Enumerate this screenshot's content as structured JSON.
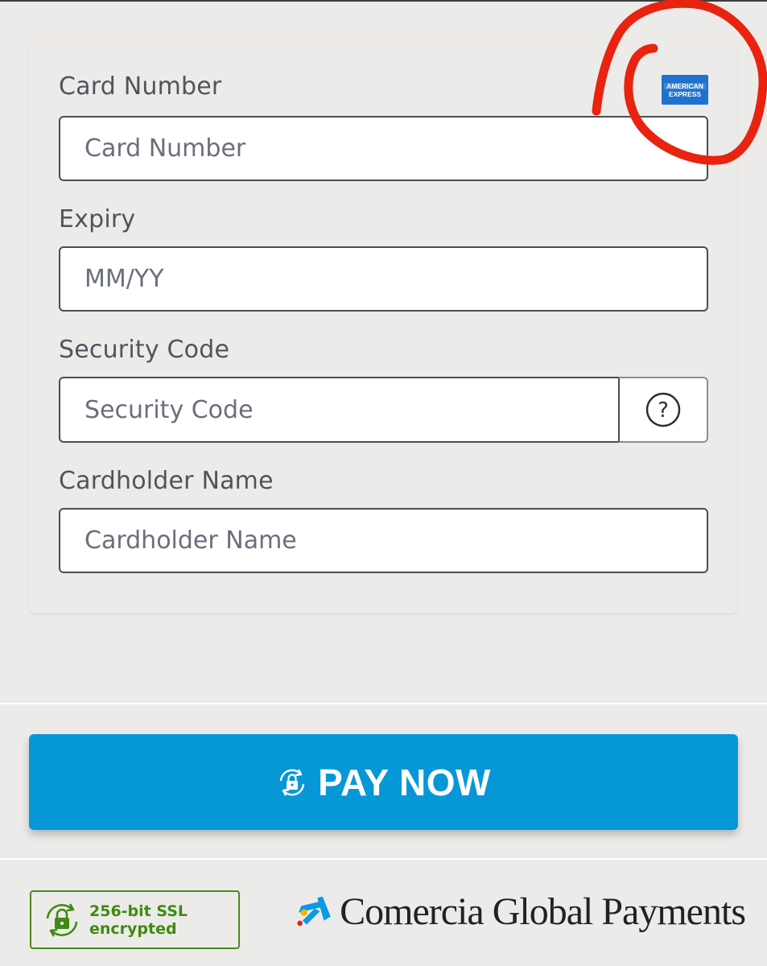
{
  "card_form": {
    "card_number": {
      "label": "Card Number",
      "placeholder": "Card Number",
      "value": ""
    },
    "expiry": {
      "label": "Expiry",
      "placeholder": "MM/YY",
      "value": ""
    },
    "security_code": {
      "label": "Security Code",
      "placeholder": "Security Code",
      "value": "",
      "help_symbol": "?"
    },
    "cardholder_name": {
      "label": "Cardholder Name",
      "placeholder": "Cardholder Name",
      "value": ""
    },
    "detected_card_brand": {
      "icon": "amex-logo-icon",
      "text_line1": "AMERICAN",
      "text_line2": "EXPRESS",
      "color": "#1f72cd"
    }
  },
  "annotation": {
    "type": "hand-drawn circle",
    "color": "#e8230f"
  },
  "pay_button": {
    "label": "PAY NOW",
    "icon": "lock-refresh-icon",
    "color": "#0698d6"
  },
  "footer": {
    "ssl_badge": {
      "line1": "256-bit SSL",
      "line2": "encrypted",
      "icon": "lock-refresh-icon",
      "color": "#3f8a12"
    },
    "brand": {
      "name": "Comercia Global Payments",
      "icon": "star-logo-icon",
      "accent": "#0a9be0"
    }
  },
  "colors": {
    "background": "#edebe9",
    "field_border": "#4a4e5a",
    "text": "#50545c"
  }
}
